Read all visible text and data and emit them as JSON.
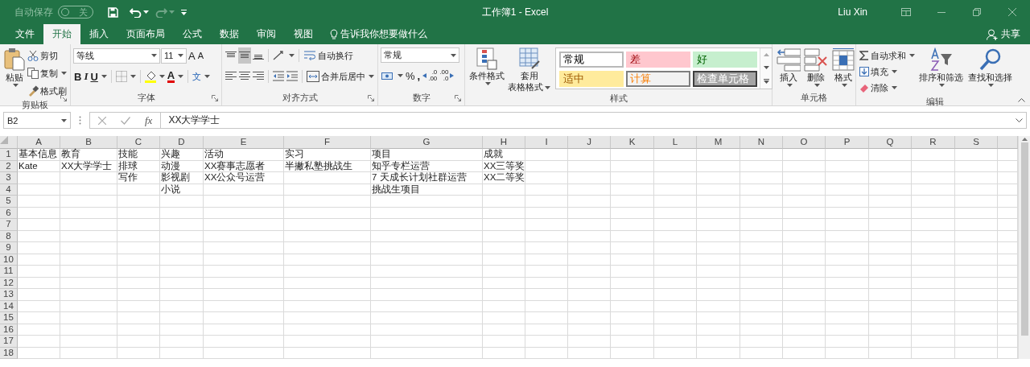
{
  "title_bar": {
    "autosave_label": "自动保存",
    "autosave_toggle": {
      "label": "关",
      "on": false
    },
    "title": "工作簿1 - Excel",
    "user": "Liu Xin"
  },
  "tabs": [
    {
      "label": "文件",
      "selected": false
    },
    {
      "label": "开始",
      "selected": true
    },
    {
      "label": "插入",
      "selected": false
    },
    {
      "label": "页面布局",
      "selected": false
    },
    {
      "label": "公式",
      "selected": false
    },
    {
      "label": "数据",
      "selected": false
    },
    {
      "label": "审阅",
      "selected": false
    },
    {
      "label": "视图",
      "selected": false
    }
  ],
  "tell_me": "告诉我你想要做什么",
  "share": "共享",
  "ribbon": {
    "clipboard": {
      "label": "剪贴板",
      "paste": "粘贴",
      "cut": "剪切",
      "copy": "复制",
      "format_painter": "格式刷"
    },
    "font": {
      "label": "字体",
      "font_name": "等线",
      "font_size": "11",
      "grow": "A",
      "shrink": "A",
      "bold": "B",
      "italic": "I",
      "underline": "U",
      "font_color": "A",
      "phonetic": "文"
    },
    "alignment": {
      "label": "对齐方式",
      "vertical_align": [
        {
          "selected": false
        },
        {
          "selected": true
        },
        {
          "selected": false
        }
      ],
      "wrap_text": "自动换行",
      "merge_center": "合并后居中"
    },
    "number": {
      "label": "数字",
      "format": "常规",
      "percent": "%",
      "comma": ",",
      "increase_decimal": [
        ".0",
        ".00"
      ],
      "decrease_decimal": [
        ".00",
        ".0"
      ]
    },
    "styles": {
      "label": "样式",
      "conditional_formatting": "条件格式",
      "format_as_table": [
        "套用",
        "表格格式"
      ],
      "cell_styles": [
        {
          "label": "常规",
          "kind": "normal"
        },
        {
          "label": "差",
          "kind": "bad"
        },
        {
          "label": "好",
          "kind": "good"
        },
        {
          "label": "适中",
          "kind": "neutral"
        },
        {
          "label": "计算",
          "kind": "calculation"
        },
        {
          "label": "检查单元格",
          "kind": "check"
        }
      ]
    },
    "cells": {
      "label": "单元格",
      "insert": "插入",
      "delete": "删除",
      "format": "格式"
    },
    "editing": {
      "label": "编辑",
      "autosum": "自动求和",
      "fill": "填充",
      "clear": "清除",
      "sort_filter": "排序和筛选",
      "find_select": "查找和选择"
    }
  },
  "formula_bar": {
    "name_box": "B2",
    "fx": "fx",
    "value": "XX大学学士"
  },
  "sheet": {
    "columns": [
      "A",
      "B",
      "C",
      "D",
      "E",
      "F",
      "G",
      "H",
      "I",
      "J",
      "K",
      "L",
      "M",
      "N",
      "O",
      "P",
      "Q",
      "R",
      "S"
    ],
    "rows": [
      {
        "header": "1",
        "cells": {
          "A": "基本信息",
          "B": "教育",
          "C": "技能",
          "D": "兴趣",
          "E": "活动",
          "F": "实习",
          "G": "项目",
          "H": "成就"
        }
      },
      {
        "header": "2",
        "cells": {
          "A": "Kate",
          "B": "XX大学学士",
          "C": "排球",
          "D": "动漫",
          "E": "XX赛事志愿者",
          "F": "半撇私塾挑战生",
          "G": "知乎专栏运营",
          "H": "XX三等奖"
        }
      },
      {
        "header": "3",
        "cells": {
          "C": "写作",
          "D": "影视剧",
          "E": "XX公众号运营",
          "G": "7 天成长计划社群运营",
          "H": "XX二等奖"
        }
      },
      {
        "header": "4",
        "cells": {
          "D": "小说",
          "G": "挑战生项目"
        }
      },
      {
        "header": "5"
      },
      {
        "header": "6"
      },
      {
        "header": "7"
      },
      {
        "header": "8"
      },
      {
        "header": "9"
      },
      {
        "header": "10"
      },
      {
        "header": "11"
      },
      {
        "header": "12"
      },
      {
        "header": "13"
      },
      {
        "header": "14"
      },
      {
        "header": "15"
      },
      {
        "header": "16"
      },
      {
        "header": "17"
      },
      {
        "header": "18"
      }
    ]
  }
}
